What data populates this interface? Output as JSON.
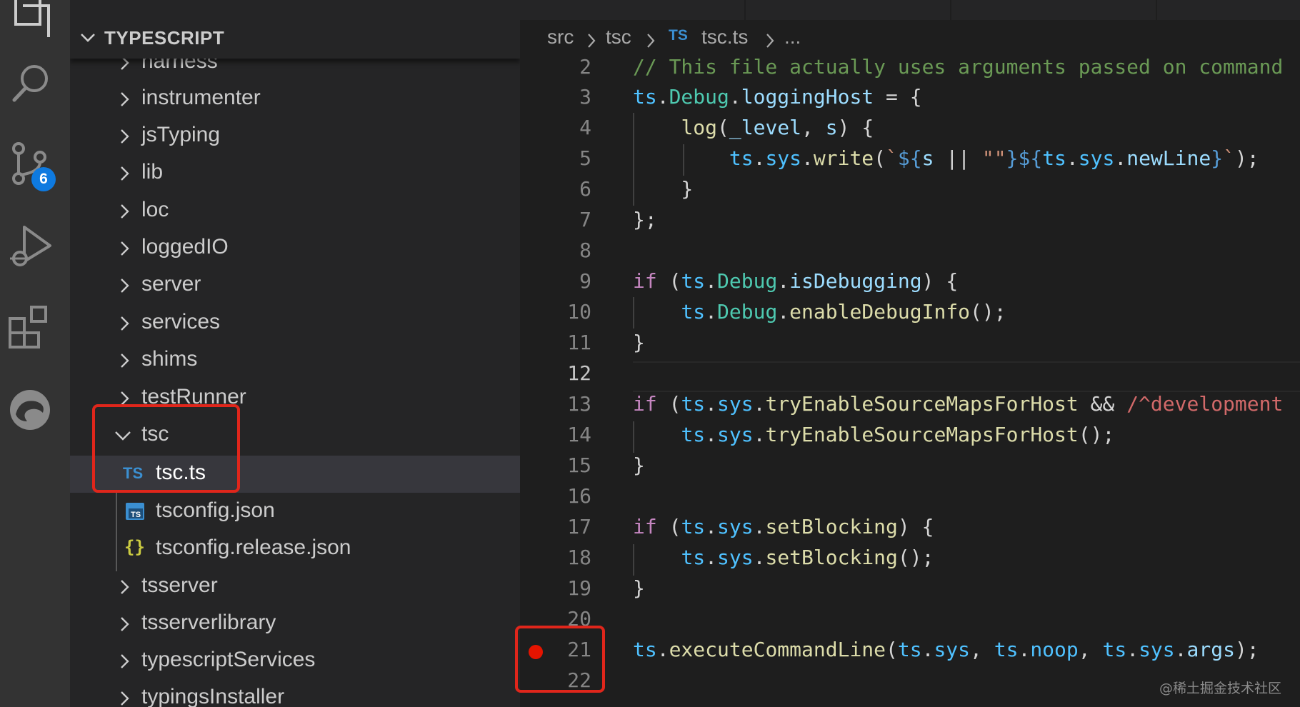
{
  "activity_bar": {
    "items": [
      {
        "name": "explorer-icon"
      },
      {
        "name": "search-icon"
      },
      {
        "name": "source-control-icon",
        "badge": "6"
      },
      {
        "name": "run-debug-icon"
      },
      {
        "name": "extensions-icon"
      },
      {
        "name": "edge-devtools-icon"
      }
    ]
  },
  "sidebar": {
    "title": "TYPESCRIPT",
    "items": [
      {
        "label": "harness",
        "type": "folder",
        "expanded": false
      },
      {
        "label": "instrumenter",
        "type": "folder",
        "expanded": false
      },
      {
        "label": "jsTyping",
        "type": "folder",
        "expanded": false
      },
      {
        "label": "lib",
        "type": "folder",
        "expanded": false
      },
      {
        "label": "loc",
        "type": "folder",
        "expanded": false
      },
      {
        "label": "loggedIO",
        "type": "folder",
        "expanded": false
      },
      {
        "label": "server",
        "type": "folder",
        "expanded": false
      },
      {
        "label": "services",
        "type": "folder",
        "expanded": false
      },
      {
        "label": "shims",
        "type": "folder",
        "expanded": false
      },
      {
        "label": "testRunner",
        "type": "folder",
        "expanded": false
      },
      {
        "label": "tsc",
        "type": "folder",
        "expanded": true
      },
      {
        "label": "tsc.ts",
        "type": "ts-file",
        "icon_text": "TS",
        "selected": true
      },
      {
        "label": "tsconfig.json",
        "type": "tsconfig-file"
      },
      {
        "label": "tsconfig.release.json",
        "type": "json-file",
        "icon_text": "{}"
      },
      {
        "label": "tsserver",
        "type": "folder",
        "expanded": false
      },
      {
        "label": "tsserverlibrary",
        "type": "folder",
        "expanded": false
      },
      {
        "label": "typescriptServices",
        "type": "folder",
        "expanded": false
      },
      {
        "label": "typingsInstaller",
        "type": "folder",
        "expanded": false
      }
    ]
  },
  "breadcrumb": {
    "parts": [
      "src",
      "tsc"
    ],
    "file_icon": "TS",
    "file": "tsc.ts",
    "more": "..."
  },
  "editor": {
    "active_line": "12",
    "breakpoint_line": "21",
    "lines": [
      {
        "n": "2",
        "tokens": [
          [
            "com",
            "// This file actually uses arguments passed on command"
          ]
        ]
      },
      {
        "n": "3",
        "tokens": [
          [
            "var",
            "ts"
          ],
          [
            "punc",
            "."
          ],
          [
            "cls",
            "Debug"
          ],
          [
            "punc",
            "."
          ],
          [
            "par",
            "loggingHost"
          ],
          [
            "punc",
            " = {"
          ]
        ]
      },
      {
        "n": "4",
        "tokens": [
          [
            "punc",
            "    "
          ],
          [
            "fn",
            "log"
          ],
          [
            "punc",
            "("
          ],
          [
            "par",
            "_level"
          ],
          [
            "punc",
            ", "
          ],
          [
            "par",
            "s"
          ],
          [
            "punc",
            ") {"
          ]
        ]
      },
      {
        "n": "5",
        "tokens": [
          [
            "punc",
            "        "
          ],
          [
            "var",
            "ts"
          ],
          [
            "punc",
            "."
          ],
          [
            "var",
            "sys"
          ],
          [
            "punc",
            "."
          ],
          [
            "fn",
            "write"
          ],
          [
            "punc",
            "("
          ],
          [
            "str",
            "`"
          ],
          [
            "tpl",
            "${"
          ],
          [
            "par",
            "s"
          ],
          [
            "punc",
            " || "
          ],
          [
            "str",
            "\"\""
          ],
          [
            "tpl",
            "}${"
          ],
          [
            "var",
            "ts"
          ],
          [
            "punc",
            "."
          ],
          [
            "var",
            "sys"
          ],
          [
            "punc",
            "."
          ],
          [
            "par",
            "newLine"
          ],
          [
            "tpl",
            "}"
          ],
          [
            "str",
            "`"
          ],
          [
            "punc",
            ");"
          ]
        ]
      },
      {
        "n": "6",
        "tokens": [
          [
            "punc",
            "    }"
          ]
        ]
      },
      {
        "n": "7",
        "tokens": [
          [
            "punc",
            "};"
          ]
        ]
      },
      {
        "n": "8",
        "tokens": []
      },
      {
        "n": "9",
        "tokens": [
          [
            "kw",
            "if"
          ],
          [
            "punc",
            " ("
          ],
          [
            "var",
            "ts"
          ],
          [
            "punc",
            "."
          ],
          [
            "cls",
            "Debug"
          ],
          [
            "punc",
            "."
          ],
          [
            "par",
            "isDebugging"
          ],
          [
            "punc",
            ") {"
          ]
        ]
      },
      {
        "n": "10",
        "tokens": [
          [
            "punc",
            "    "
          ],
          [
            "var",
            "ts"
          ],
          [
            "punc",
            "."
          ],
          [
            "cls",
            "Debug"
          ],
          [
            "punc",
            "."
          ],
          [
            "fn",
            "enableDebugInfo"
          ],
          [
            "punc",
            "();"
          ]
        ]
      },
      {
        "n": "11",
        "tokens": [
          [
            "punc",
            "}"
          ]
        ]
      },
      {
        "n": "12",
        "tokens": []
      },
      {
        "n": "13",
        "tokens": [
          [
            "kw",
            "if"
          ],
          [
            "punc",
            " ("
          ],
          [
            "var",
            "ts"
          ],
          [
            "punc",
            "."
          ],
          [
            "var",
            "sys"
          ],
          [
            "punc",
            "."
          ],
          [
            "fn",
            "tryEnableSourceMapsForHost"
          ],
          [
            "punc",
            " && "
          ],
          [
            "re",
            "/^development"
          ]
        ]
      },
      {
        "n": "14",
        "tokens": [
          [
            "punc",
            "    "
          ],
          [
            "var",
            "ts"
          ],
          [
            "punc",
            "."
          ],
          [
            "var",
            "sys"
          ],
          [
            "punc",
            "."
          ],
          [
            "fn",
            "tryEnableSourceMapsForHost"
          ],
          [
            "punc",
            "();"
          ]
        ]
      },
      {
        "n": "15",
        "tokens": [
          [
            "punc",
            "}"
          ]
        ]
      },
      {
        "n": "16",
        "tokens": []
      },
      {
        "n": "17",
        "tokens": [
          [
            "kw",
            "if"
          ],
          [
            "punc",
            " ("
          ],
          [
            "var",
            "ts"
          ],
          [
            "punc",
            "."
          ],
          [
            "var",
            "sys"
          ],
          [
            "punc",
            "."
          ],
          [
            "fn",
            "setBlocking"
          ],
          [
            "punc",
            ") {"
          ]
        ]
      },
      {
        "n": "18",
        "tokens": [
          [
            "punc",
            "    "
          ],
          [
            "var",
            "ts"
          ],
          [
            "punc",
            "."
          ],
          [
            "var",
            "sys"
          ],
          [
            "punc",
            "."
          ],
          [
            "fn",
            "setBlocking"
          ],
          [
            "punc",
            "();"
          ]
        ]
      },
      {
        "n": "19",
        "tokens": [
          [
            "punc",
            "}"
          ]
        ]
      },
      {
        "n": "20",
        "tokens": []
      },
      {
        "n": "21",
        "tokens": [
          [
            "var",
            "ts"
          ],
          [
            "punc",
            "."
          ],
          [
            "fn",
            "executeCommandLine"
          ],
          [
            "punc",
            "("
          ],
          [
            "var",
            "ts"
          ],
          [
            "punc",
            "."
          ],
          [
            "var",
            "sys"
          ],
          [
            "punc",
            ", "
          ],
          [
            "var",
            "ts"
          ],
          [
            "punc",
            "."
          ],
          [
            "var",
            "noop"
          ],
          [
            "punc",
            ", "
          ],
          [
            "var",
            "ts"
          ],
          [
            "punc",
            "."
          ],
          [
            "var",
            "sys"
          ],
          [
            "punc",
            "."
          ],
          [
            "par",
            "args"
          ],
          [
            "punc",
            ");"
          ]
        ]
      },
      {
        "n": "22",
        "tokens": []
      }
    ]
  },
  "watermark": "@稀土掘金技术社区",
  "colors": {
    "activity_bg": "#333333",
    "sidebar_bg": "#252526",
    "editor_bg": "#1e1e1e",
    "selection_bg": "#37373d",
    "badge": "#0e7ae0",
    "breakpoint": "#e51400",
    "highlight_box": "#e0261b",
    "ts_icon": "#3b8fd1",
    "json_icon": "#cbcb41"
  }
}
